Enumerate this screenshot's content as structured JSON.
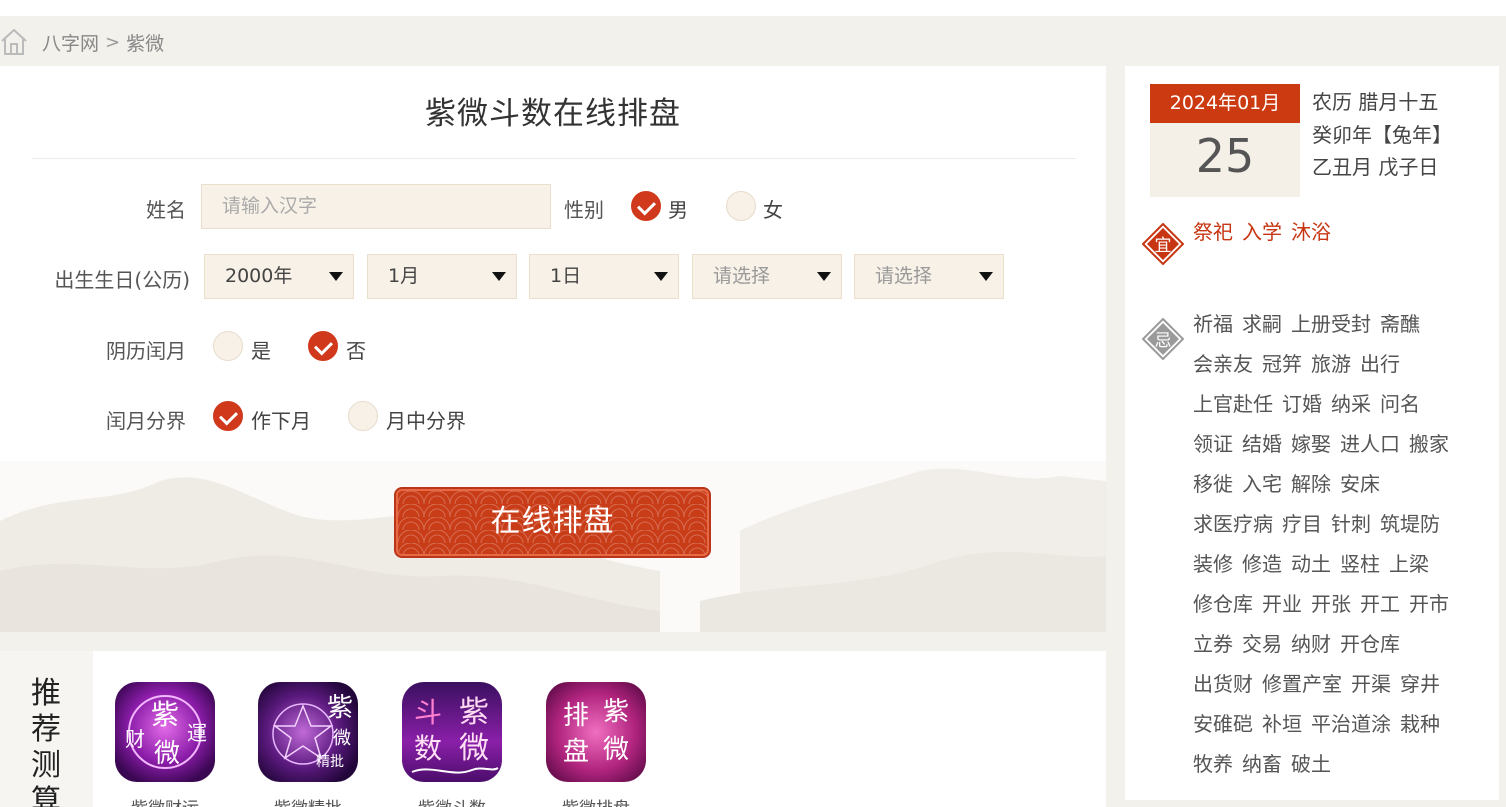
{
  "breadcrumb": {
    "home": "八字网",
    "current": "紫微"
  },
  "form": {
    "title": "紫微斗数在线排盘",
    "name_label": "姓名",
    "name_placeholder": "请输入汉字",
    "gender_label": "性别",
    "gender_male": "男",
    "gender_female": "女",
    "birthday_label": "出生生日(公历)",
    "year": "2000年",
    "month": "1月",
    "day": "1日",
    "hour_placeholder": "请选择",
    "minute_placeholder": "请选择",
    "leap_label": "阴历闰月",
    "leap_yes": "是",
    "leap_no": "否",
    "split_label": "闰月分界",
    "split_next": "作下月",
    "split_mid": "月中分界",
    "submit": "在线排盘"
  },
  "recommend": {
    "title": "推荐测算",
    "apps": [
      {
        "name": "紫微财运",
        "icon": "ziwei-wealth-icon"
      },
      {
        "name": "紫微精批",
        "icon": "ziwei-detailed-icon"
      },
      {
        "name": "紫微斗数",
        "icon": "ziwei-doushu-icon"
      },
      {
        "name": "紫微排盘",
        "icon": "ziwei-chart-icon"
      }
    ]
  },
  "calendar": {
    "year_month": "2024年01月",
    "day": "25",
    "lunar_line1": "农历 腊月十五",
    "lunar_line2": "癸卯年【兔年】",
    "lunar_line3": "乙丑月 戊子日",
    "yi_badge": "宜",
    "ji_badge": "忌",
    "yi": [
      "祭祀",
      "入学",
      "沐浴"
    ],
    "ji_rows": [
      [
        "祈福",
        "求嗣",
        "上册受封",
        "斋醮"
      ],
      [
        "会亲友",
        "冠笄",
        "旅游",
        "出行"
      ],
      [
        "上官赴任",
        "订婚",
        "纳采",
        "问名"
      ],
      [
        "领证",
        "结婚",
        "嫁娶",
        "进人口",
        "搬家"
      ],
      [
        "移徙",
        "入宅",
        "解除",
        "安床"
      ],
      [
        "求医疗病",
        "疗目",
        "针刺",
        "筑堤防"
      ],
      [
        "装修",
        "修造",
        "动土",
        "竖柱",
        "上梁"
      ],
      [
        "修仓库",
        "开业",
        "开张",
        "开工",
        "开市"
      ],
      [
        "立券",
        "交易",
        "纳财",
        "开仓库"
      ],
      [
        "出货财",
        "修置产室",
        "开渠",
        "穿井"
      ],
      [
        "安碓硙",
        "补垣",
        "平治道涂",
        "栽种"
      ],
      [
        "牧养",
        "纳畜",
        "破土"
      ]
    ]
  },
  "colors": {
    "accent": "#cc3a12",
    "input_bg": "#f7f1e7",
    "page_bg": "#f3f1ec"
  }
}
